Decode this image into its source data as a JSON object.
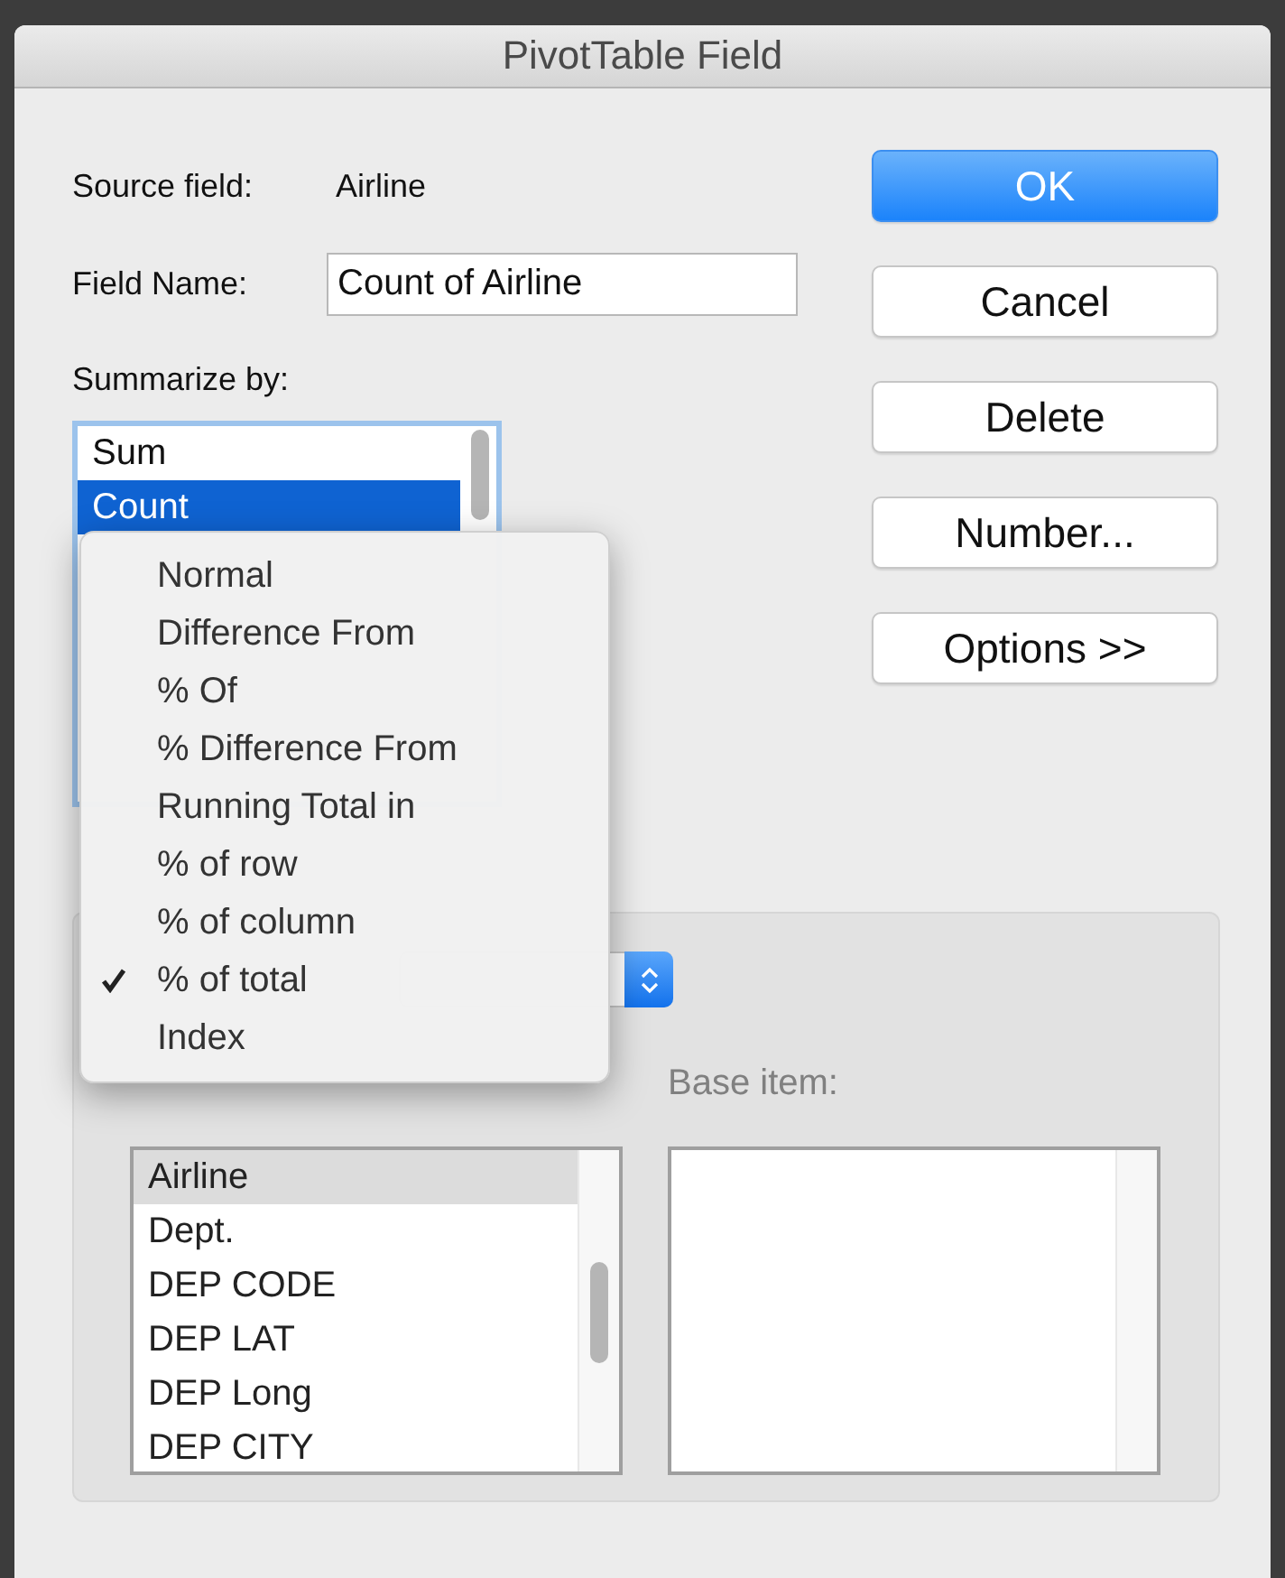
{
  "window": {
    "title": "PivotTable Field"
  },
  "source_field": {
    "label": "Source field:",
    "value": "Airline"
  },
  "field_name": {
    "label": "Field Name:",
    "value": "Count of Airline"
  },
  "summarize_by": {
    "label": "Summarize by:",
    "items": [
      {
        "label": "Sum",
        "selected": false
      },
      {
        "label": "Count",
        "selected": true
      }
    ]
  },
  "buttons": [
    {
      "label": "OK",
      "default": true
    },
    {
      "label": "Cancel",
      "default": false
    },
    {
      "label": "Delete",
      "default": false
    },
    {
      "label": "Number...",
      "default": false
    },
    {
      "label": "Options >>",
      "default": false
    }
  ],
  "show_data_as_menu": {
    "items": [
      {
        "label": "Normal",
        "checked": false
      },
      {
        "label": "Difference From",
        "checked": false
      },
      {
        "label": "% Of",
        "checked": false
      },
      {
        "label": "% Difference From",
        "checked": false
      },
      {
        "label": "Running Total in",
        "checked": false
      },
      {
        "label": "% of row",
        "checked": false
      },
      {
        "label": "% of column",
        "checked": false
      },
      {
        "label": "% of total",
        "checked": true
      },
      {
        "label": "Index",
        "checked": false
      }
    ]
  },
  "base_field": {
    "items": [
      {
        "label": "Airline",
        "selected": true
      },
      {
        "label": "Dept.",
        "selected": false
      },
      {
        "label": "DEP CODE",
        "selected": false
      },
      {
        "label": "DEP LAT",
        "selected": false
      },
      {
        "label": "DEP Long",
        "selected": false
      },
      {
        "label": "DEP CITY",
        "selected": false
      }
    ]
  },
  "base_item": {
    "label": "Base item:"
  }
}
